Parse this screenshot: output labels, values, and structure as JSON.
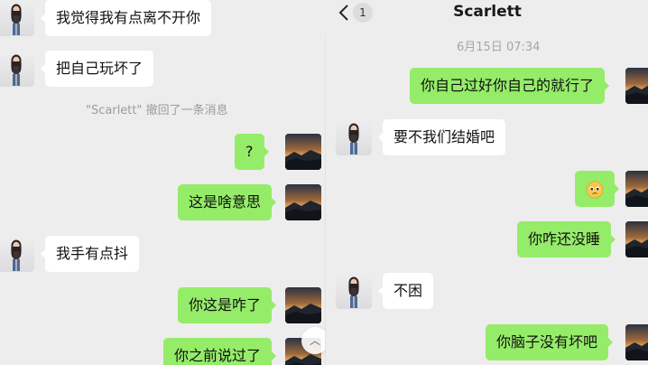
{
  "left_chat": {
    "messages": [
      {
        "side": "received",
        "text": "我觉得我有点离不开你"
      },
      {
        "side": "received",
        "text": "把自己玩坏了"
      },
      {
        "type": "system",
        "text": "\"Scarlett\" 撤回了一条消息"
      },
      {
        "side": "sent",
        "text": "?"
      },
      {
        "side": "sent",
        "text": "这是啥意思"
      },
      {
        "side": "received",
        "text": "我手有点抖"
      },
      {
        "side": "sent",
        "text": "你这是咋了"
      },
      {
        "side": "sent",
        "text": "你之前说过了"
      }
    ],
    "scroll_button_icon": "chevron-up-icon"
  },
  "right_chat": {
    "header": {
      "back_icon": "chevron-left-icon",
      "unread_count": "1",
      "title": "Scarlett"
    },
    "timestamp": "6月15日 07:34",
    "messages": [
      {
        "side": "sent",
        "text": "你自己过好你自己的就行了"
      },
      {
        "side": "received",
        "text": "要不我们结婚吧"
      },
      {
        "side": "sent",
        "type": "emoji",
        "emoji": "pleading-face-emoji"
      },
      {
        "side": "sent",
        "text": "你咋还没睡"
      },
      {
        "side": "received",
        "text": "不困"
      },
      {
        "side": "sent",
        "text": "你脑子没有坏吧"
      }
    ]
  },
  "colors": {
    "background": "#ededed",
    "sent_bubble": "#95ec69",
    "received_bubble": "#ffffff",
    "system_text": "#9b9b9b"
  }
}
